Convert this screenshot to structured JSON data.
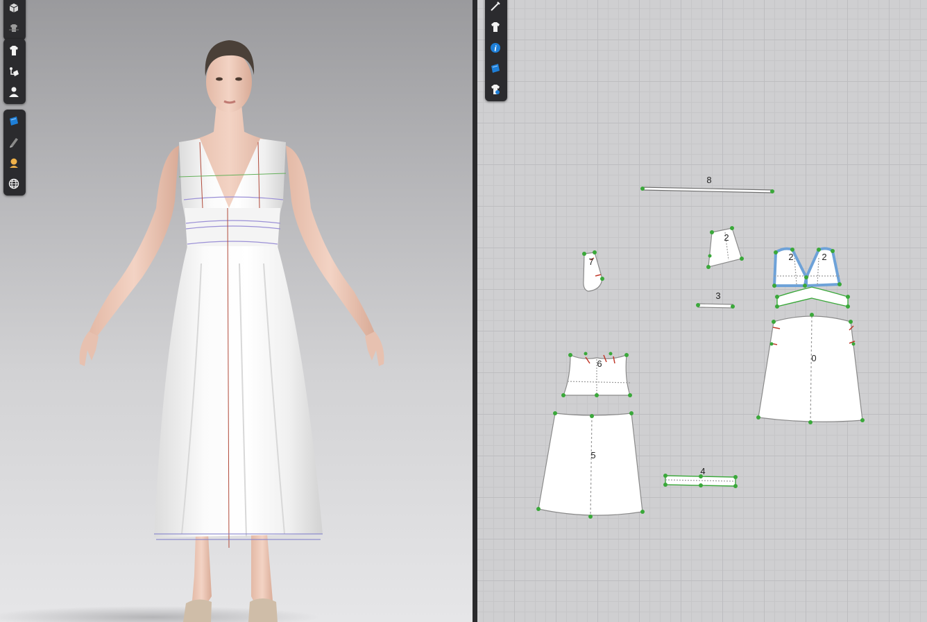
{
  "colors": {
    "toolbar_bg": "#2b2b2e",
    "icon_white": "#f2f2f2",
    "icon_blue": "#1e7fd8",
    "icon_amber": "#f0b24a",
    "pattern_fill": "#ffffff",
    "seam_green": "#3aa83a",
    "selection_blue": "#6ea2d8"
  },
  "toolbar_3d": {
    "group1": [
      {
        "icon": "cube-icon"
      },
      {
        "icon": "garment-stack-icon"
      }
    ],
    "group2": [
      {
        "icon": "tshirt-icon"
      },
      {
        "icon": "fold-arrange-icon"
      },
      {
        "icon": "avatar-icon"
      }
    ],
    "group3": [
      {
        "icon": "texture-map-icon"
      },
      {
        "icon": "pen-icon"
      },
      {
        "icon": "light-bulb-icon"
      },
      {
        "icon": "globe-icon"
      }
    ]
  },
  "toolbar_2d": [
    {
      "icon": "pen-tool-icon"
    },
    {
      "icon": "tshirt-icon"
    },
    {
      "icon": "info-icon"
    },
    {
      "icon": "texture-map-icon"
    },
    {
      "icon": "garment-settings-icon"
    }
  ],
  "pattern_labels": {
    "piece_8": "8",
    "piece_2_small": "2",
    "piece_7": "7",
    "piece_3": "3",
    "piece_2_left": "2",
    "piece_2_right": "2",
    "piece_0": "0",
    "piece_6": "6",
    "piece_5": "5",
    "piece_4": "4"
  }
}
